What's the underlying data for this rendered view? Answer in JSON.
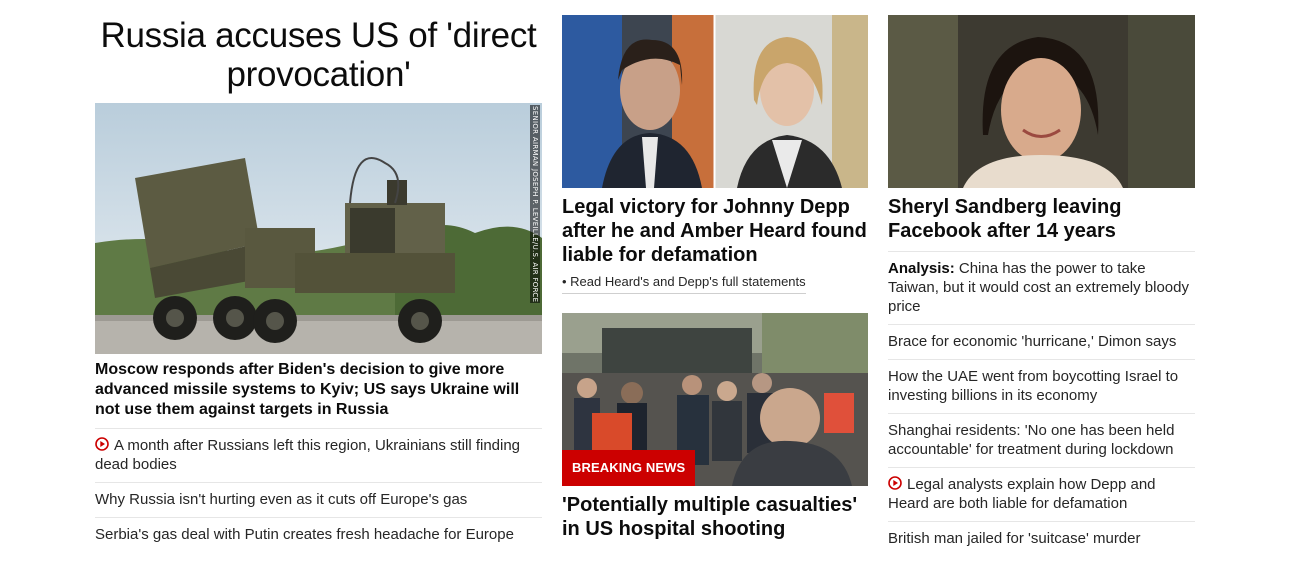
{
  "left": {
    "headline": "Russia accuses US of 'direct provocation'",
    "image_credit": "SENIOR AIRMAN JOSEPH P. LEVEILLE/U.S. AIR FORCE",
    "lead_text": "Moscow responds after Biden's decision to give more advanced missile systems to Kyiv; US says Ukraine will not use them against targets in Russia",
    "items": [
      {
        "text": "A month after Russians left this region, Ukrainians still finding dead bodies",
        "video": true
      },
      {
        "text": "Why Russia isn't hurting even as it cuts off Europe's gas",
        "video": false
      },
      {
        "text": "Serbia's gas deal with Putin creates fresh headache for Europe",
        "video": false
      }
    ]
  },
  "middle": {
    "story1": {
      "headline": "Legal victory for Johnny Depp after he and Amber Heard found liable for defamation",
      "sublink": "• Read Heard's and Depp's full statements"
    },
    "story2": {
      "badge": "BREAKING NEWS",
      "headline": "'Potentially multiple casualties' in US hospital shooting"
    }
  },
  "right": {
    "headline": "Sheryl Sandberg leaving Facebook after 14 years",
    "items": [
      {
        "prefix": "Analysis:",
        "text": " China has the power to take Taiwan, but it would cost an extremely bloody price",
        "video": false
      },
      {
        "prefix": "",
        "text": "Brace for economic 'hurricane,' Dimon says",
        "video": false
      },
      {
        "prefix": "",
        "text": "How the UAE went from boycotting Israel to investing billions in its economy",
        "video": false
      },
      {
        "prefix": "",
        "text": "Shanghai residents: 'No one has been held accountable' for treatment during lockdown",
        "video": false
      },
      {
        "prefix": "",
        "text": "Legal analysts explain how Depp and Heard are both liable for defamation",
        "video": true
      },
      {
        "prefix": "",
        "text": "British man jailed for 'suitcase' murder",
        "video": false
      }
    ]
  },
  "colors": {
    "accent": "#cc0000",
    "text": "#0c0c0c",
    "divider": "#e6e6e6"
  }
}
